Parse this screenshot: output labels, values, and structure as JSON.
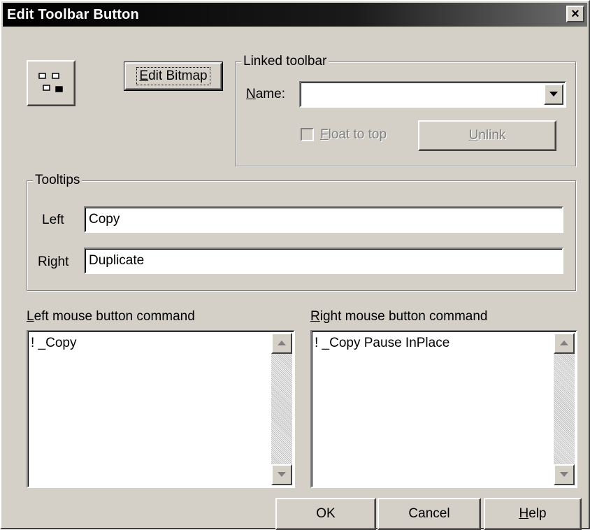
{
  "window": {
    "title": "Edit Toolbar Button",
    "close_label": "×"
  },
  "bitmap_icon": "toolbar-bitmap-icon",
  "edit_bitmap_button": {
    "label_pre": "",
    "label_ul": "E",
    "label_post": "dit Bitmap"
  },
  "linked_toolbar": {
    "legend": "Linked toolbar",
    "name_label_ul": "N",
    "name_label_post": "ame:",
    "name_value": "",
    "float_label_ul": "F",
    "float_label_post": "loat to top",
    "float_checked": false,
    "unlink_ul": "U",
    "unlink_post": "nlink"
  },
  "tooltips": {
    "legend": "Tooltips",
    "left_label": "Left",
    "left_value": "Copy",
    "right_label": "Right",
    "right_value": "Duplicate"
  },
  "left_command": {
    "label_ul": "L",
    "label_post": "eft mouse button command",
    "value": "! _Copy"
  },
  "right_command": {
    "label_ul": "R",
    "label_post": "ight mouse button command",
    "value": "! _Copy Pause InPlace"
  },
  "buttons": {
    "ok": "OK",
    "cancel": "Cancel",
    "help_ul": "H",
    "help_post": "elp"
  }
}
